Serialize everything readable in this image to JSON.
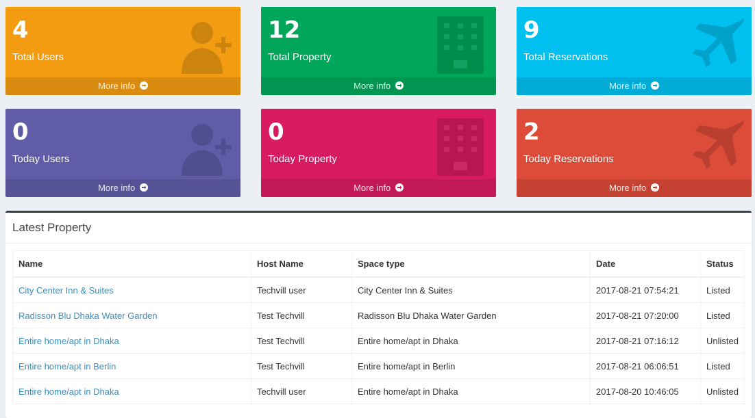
{
  "stats": [
    {
      "count": "4",
      "label": "Total Users",
      "footer": "More info",
      "icon": "user-plus-icon",
      "color": "#f39c12"
    },
    {
      "count": "12",
      "label": "Total Property",
      "footer": "More info",
      "icon": "building-icon",
      "color": "#00a65a"
    },
    {
      "count": "9",
      "label": "Total Reservations",
      "footer": "More info",
      "icon": "plane-icon",
      "color": "#00c0ef"
    },
    {
      "count": "0",
      "label": "Today Users",
      "footer": "More info",
      "icon": "user-plus-icon",
      "color": "#605ca8"
    },
    {
      "count": "0",
      "label": "Today Property",
      "footer": "More info",
      "icon": "building-icon",
      "color": "#d81b60"
    },
    {
      "count": "2",
      "label": "Today Reservations",
      "footer": "More info",
      "icon": "plane-icon",
      "color": "#dd4b39"
    }
  ],
  "latest": {
    "title": "Latest Property",
    "columns": [
      "Name",
      "Host Name",
      "Space type",
      "Date",
      "Status"
    ],
    "rows": [
      {
        "name": "City Center Inn & Suites",
        "host": "Techvill user",
        "space": "City Center Inn & Suites",
        "date": "2017-08-21 07:54:21",
        "status": "Listed"
      },
      {
        "name": "Radisson Blu Dhaka Water Garden",
        "host": "Test Techvill",
        "space": "Radisson Blu Dhaka Water Garden",
        "date": "2017-08-21 07:20:00",
        "status": "Listed"
      },
      {
        "name": "Entire home/apt in Dhaka",
        "host": "Test Techvill",
        "space": "Entire home/apt in Dhaka",
        "date": "2017-08-21 07:16:12",
        "status": "Unlisted"
      },
      {
        "name": "Entire home/apt in Berlin",
        "host": "Test Techvill",
        "space": "Entire home/apt in Berlin",
        "date": "2017-08-21 06:06:51",
        "status": "Listed"
      },
      {
        "name": "Entire home/apt in Dhaka",
        "host": "Techvill user",
        "space": "Entire home/apt in Dhaka",
        "date": "2017-08-20 10:46:05",
        "status": "Unlisted"
      }
    ]
  }
}
